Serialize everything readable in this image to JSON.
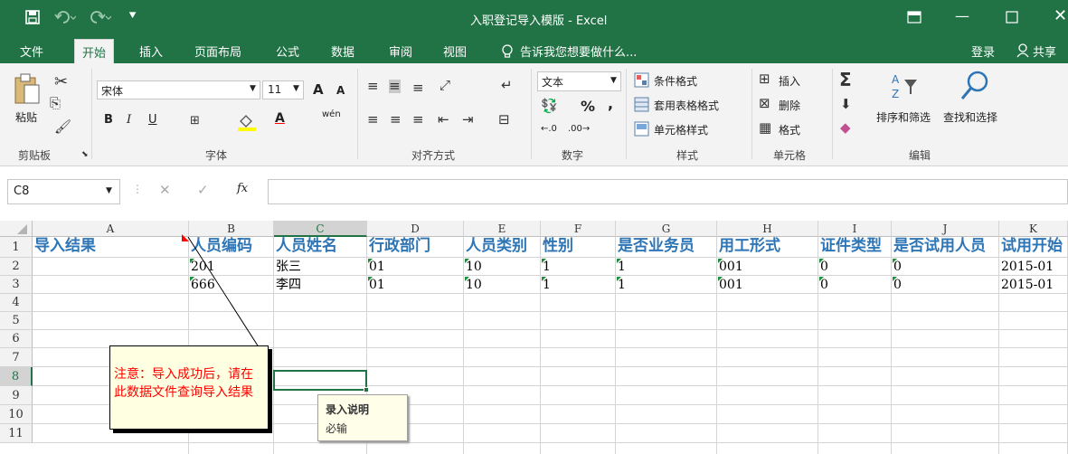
{
  "window": {
    "title": "入职登记导入模版 - Excel",
    "save_icon": "save-icon",
    "undo_icon": "undo-icon",
    "redo_icon": "redo-icon"
  },
  "tabs": [
    "文件",
    "开始",
    "插入",
    "页面布局",
    "公式",
    "数据",
    "审阅",
    "视图"
  ],
  "active_tab": "开始",
  "tell_me": "告诉我您想要做什么...",
  "account": {
    "login": "登录",
    "share": "共享"
  },
  "ribbon": {
    "clipboard": {
      "paste": "粘贴",
      "label": "剪贴板"
    },
    "font": {
      "name": "宋体",
      "size": "11",
      "bold": "B",
      "italic": "I",
      "underline": "U",
      "grow": "A",
      "shrink": "A",
      "phonetic": "wén",
      "label": "字体",
      "fill_color": "#ffff00",
      "font_color": "#ff0000"
    },
    "alignment": {
      "label": "对齐方式"
    },
    "number": {
      "format": "文本",
      "percent": "%",
      "comma": ",",
      "label": "数字"
    },
    "styles": {
      "conditional": "条件格式",
      "table": "套用表格格式",
      "cell": "单元格样式",
      "label": "样式"
    },
    "cells": {
      "insert": "插入",
      "delete": "删除",
      "format": "格式",
      "label": "单元格"
    },
    "editing": {
      "sort": "排序和筛选",
      "find": "查找和选择",
      "label": "编辑"
    }
  },
  "formula_bar": {
    "name_box": "C8",
    "fx": "fx",
    "value": ""
  },
  "sheet": {
    "columns": [
      "A",
      "B",
      "C",
      "D",
      "E",
      "F",
      "G",
      "H",
      "I",
      "J",
      "K"
    ],
    "selected_column": "C",
    "rows": [
      "1",
      "2",
      "3",
      "4",
      "5",
      "6",
      "7",
      "8",
      "9",
      "10",
      "11"
    ],
    "selected_row": "8",
    "headers": [
      "导入结果",
      "人员编码",
      "人员姓名",
      "行政部门",
      "人员类别",
      "性别",
      "是否业务员",
      "用工形式",
      "证件类型",
      "是否试用人员",
      "试用开始"
    ],
    "data": [
      [
        "",
        "201",
        "张三",
        "01",
        "10",
        "1",
        "1",
        "001",
        "0",
        "0",
        "2015-01"
      ],
      [
        "",
        "666",
        "李四",
        "01",
        "10",
        "1",
        "1",
        "001",
        "0",
        "0",
        "2015-01"
      ]
    ],
    "active_cell": "C8"
  },
  "comment": {
    "text": "注意：导入成功后，请在此数据文件查询导入结果",
    "text_color": "#ff0000"
  },
  "input_message": {
    "title": "录入说明",
    "body": "必输"
  },
  "colors": {
    "excel_green": "#217346",
    "header_blue": "#2e75b6",
    "indicator_green": "#1e8f3a"
  }
}
